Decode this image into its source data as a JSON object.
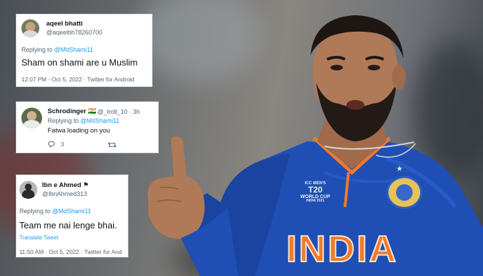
{
  "colors": {
    "link_blue": "#1d9bf0",
    "text_primary": "#0f1419",
    "text_secondary": "#536471",
    "jersey_blue": "#1f4fb5",
    "jersey_orange": "#f07a2a"
  },
  "tweets": [
    {
      "name": "aqeel bhatti",
      "handle": "@aqeelbh78260700",
      "replying_prefix": "Replying to ",
      "replying_to": "@MdShami11",
      "text": "Sham on shami are u Muslim",
      "meta": "12:07 PM · Oct 5, 2022 · Twitter for Android"
    },
    {
      "name": "Schrodinger",
      "flag": "🇮🇳",
      "handle": "@_troll_10 · 3h",
      "replying_prefix": "Replying to ",
      "replying_to": "@MdShami11",
      "text": "Fatwa loading on you",
      "reply_count": "3",
      "reply_icon": "comment-icon",
      "retweet_icon": "retweet-icon"
    },
    {
      "name": "Ibn e Ahmed",
      "flag": "⚑",
      "handle": "@IbnAhmed313",
      "replying_prefix": "Replying to ",
      "replying_to": "@MdShami11",
      "text": "Team me nai lenge bhai.",
      "translate": "Translate Tweet",
      "meta": "11:50 AM · Oct 5, 2022 · Twitter for And"
    }
  ],
  "jersey": {
    "text": "INDIA",
    "badge_lines": [
      "ICC MEN'S",
      "T20",
      "WORLD CUP",
      "INDIA 2021"
    ]
  }
}
